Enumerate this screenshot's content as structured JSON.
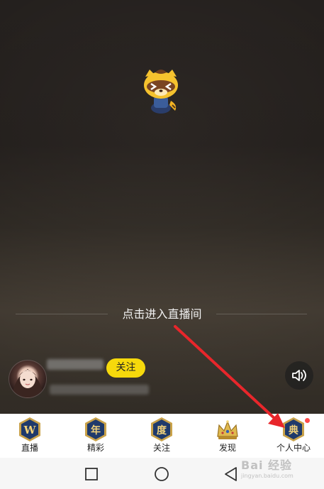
{
  "live": {
    "enter_room_text": "点击进入直播间",
    "follow_label": "关注",
    "volume_icon": "volume-icon",
    "mascot_icon": "raccoon-mascot-icon"
  },
  "bottom_nav": {
    "items": [
      {
        "label": "直播",
        "badge_char": "W",
        "icon": "badge-w-icon"
      },
      {
        "label": "精彩",
        "badge_char": "年",
        "icon": "badge-nian-icon"
      },
      {
        "label": "关注",
        "badge_char": "度",
        "icon": "badge-du-icon"
      },
      {
        "label": "发现",
        "badge_char": "",
        "icon": "crown-icon"
      },
      {
        "label": "个人中心",
        "badge_char": "典",
        "icon": "badge-dian-icon",
        "has_notification": true
      }
    ]
  },
  "system_nav": {
    "icons": [
      "recent-apps-icon",
      "home-icon",
      "back-icon"
    ]
  },
  "watermark": {
    "text": "Bai 经验",
    "subtext": "jingyan.baidu.com"
  },
  "colors": {
    "follow_button": "#f6d90c",
    "notification_dot": "#ff4b4b",
    "arrow": "#e8262b",
    "badge_gold": "#c9a24a",
    "badge_blue": "#1f3a6b"
  }
}
